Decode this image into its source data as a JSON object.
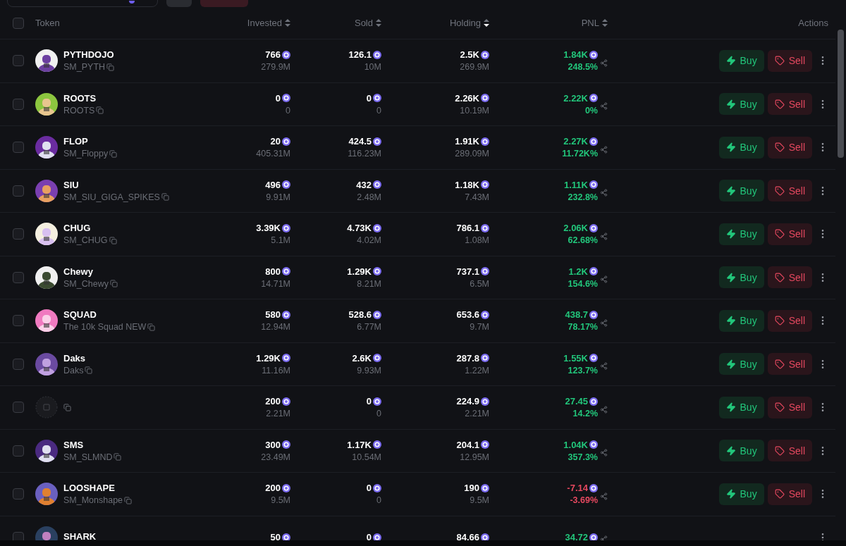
{
  "columns": [
    {
      "label": "Token",
      "sortable": false
    },
    {
      "label": "Invested",
      "sortable": true,
      "sorted": false
    },
    {
      "label": "Sold",
      "sortable": true,
      "sorted": false
    },
    {
      "label": "Holding",
      "sortable": true,
      "sorted": true
    },
    {
      "label": "PNL",
      "sortable": true,
      "sorted": false
    },
    {
      "label": "Actions",
      "sortable": false
    }
  ],
  "select_all": {
    "checked": false
  },
  "rows": [
    {
      "name": "PYTHDOJO",
      "symbol": "SM_PYTH",
      "kind": "picture",
      "checked": false,
      "invested": "766",
      "invested_sub": "279.9M",
      "sold": "126.1",
      "sold_sub": "10M",
      "holding": "2.5K",
      "holding_sub": "269.9M",
      "pnl": "1.84K",
      "pnl_pct": "248.5%",
      "loss": false,
      "buy": "Buy",
      "sell": "Sell"
    },
    {
      "name": "ROOTS",
      "symbol": "ROOTS",
      "kind": "picture",
      "checked": false,
      "invested": "0",
      "invested_sub": "0",
      "sold": "0",
      "sold_sub": "0",
      "holding": "2.26K",
      "holding_sub": "10.19M",
      "pnl": "2.22K",
      "pnl_pct": "0%",
      "loss": false,
      "buy": "Buy",
      "sell": "Sell"
    },
    {
      "name": "FLOP",
      "symbol": "SM_Floppy",
      "kind": "picture",
      "checked": false,
      "invested": "20",
      "invested_sub": "405.31M",
      "sold": "424.5",
      "sold_sub": "116.23M",
      "holding": "1.91K",
      "holding_sub": "289.09M",
      "pnl": "2.27K",
      "pnl_pct": "11.72K%",
      "loss": false,
      "buy": "Buy",
      "sell": "Sell"
    },
    {
      "name": "SIU",
      "symbol": "SM_SIU_GIGA_SPIKES",
      "kind": "picture",
      "checked": false,
      "invested": "496",
      "invested_sub": "9.91M",
      "sold": "432",
      "sold_sub": "2.48M",
      "holding": "1.18K",
      "holding_sub": "7.43M",
      "pnl": "1.11K",
      "pnl_pct": "232.8%",
      "loss": false,
      "buy": "Buy",
      "sell": "Sell"
    },
    {
      "name": "CHUG",
      "symbol": "SM_CHUG",
      "kind": "picture",
      "checked": false,
      "invested": "3.39K",
      "invested_sub": "5.1M",
      "sold": "4.73K",
      "sold_sub": "4.02M",
      "holding": "786.1",
      "holding_sub": "1.08M",
      "pnl": "2.06K",
      "pnl_pct": "62.68%",
      "loss": false,
      "buy": "Buy",
      "sell": "Sell"
    },
    {
      "name": "Chewy",
      "symbol": "SM_Chewy",
      "kind": "picture",
      "checked": false,
      "invested": "800",
      "invested_sub": "14.71M",
      "sold": "1.29K",
      "sold_sub": "8.21M",
      "holding": "737.1",
      "holding_sub": "6.5M",
      "pnl": "1.2K",
      "pnl_pct": "154.6%",
      "loss": false,
      "buy": "Buy",
      "sell": "Sell"
    },
    {
      "name": "SQUAD",
      "symbol": "The 10k Squad NEW",
      "kind": "picture",
      "checked": false,
      "invested": "580",
      "invested_sub": "12.94M",
      "sold": "528.6",
      "sold_sub": "6.77M",
      "holding": "653.6",
      "holding_sub": "9.7M",
      "pnl": "438.7",
      "pnl_pct": "78.17%",
      "loss": false,
      "buy": "Buy",
      "sell": "Sell"
    },
    {
      "name": "Daks",
      "symbol": "Daks",
      "kind": "picture",
      "checked": false,
      "invested": "1.29K",
      "invested_sub": "11.16M",
      "sold": "2.6K",
      "sold_sub": "9.93M",
      "holding": "287.8",
      "holding_sub": "1.22M",
      "pnl": "1.55K",
      "pnl_pct": "123.7%",
      "loss": false,
      "buy": "Buy",
      "sell": "Sell"
    },
    {
      "kind": "placeholder",
      "checked": false,
      "invested": "200",
      "invested_sub": "2.21M",
      "sold": "0",
      "sold_sub": "0",
      "holding": "224.9",
      "holding_sub": "2.21M",
      "pnl": "27.45",
      "pnl_pct": "14.2%",
      "loss": false,
      "buy": "Buy",
      "sell": "Sell"
    },
    {
      "name": "SMS",
      "symbol": "SM_SLMND",
      "kind": "picture",
      "checked": false,
      "invested": "300",
      "invested_sub": "23.49M",
      "sold": "1.17K",
      "sold_sub": "10.54M",
      "holding": "204.1",
      "holding_sub": "12.95M",
      "pnl": "1.04K",
      "pnl_pct": "357.3%",
      "loss": false,
      "buy": "Buy",
      "sell": "Sell"
    },
    {
      "name": "LOOSHAPE",
      "symbol": "SM_Monshape",
      "kind": "picture",
      "checked": false,
      "invested": "200",
      "invested_sub": "9.5M",
      "sold": "0",
      "sold_sub": "0",
      "holding": "190",
      "holding_sub": "9.5M",
      "pnl": "-7.14",
      "pnl_pct": "-3.69%",
      "loss": true,
      "buy": "Buy",
      "sell": "Sell"
    },
    {
      "name": "SHARK",
      "kind": "picture",
      "checked": false,
      "invested": "50",
      "sold": "0",
      "holding": "84.66",
      "pnl": "34.72",
      "loss": false
    }
  ]
}
